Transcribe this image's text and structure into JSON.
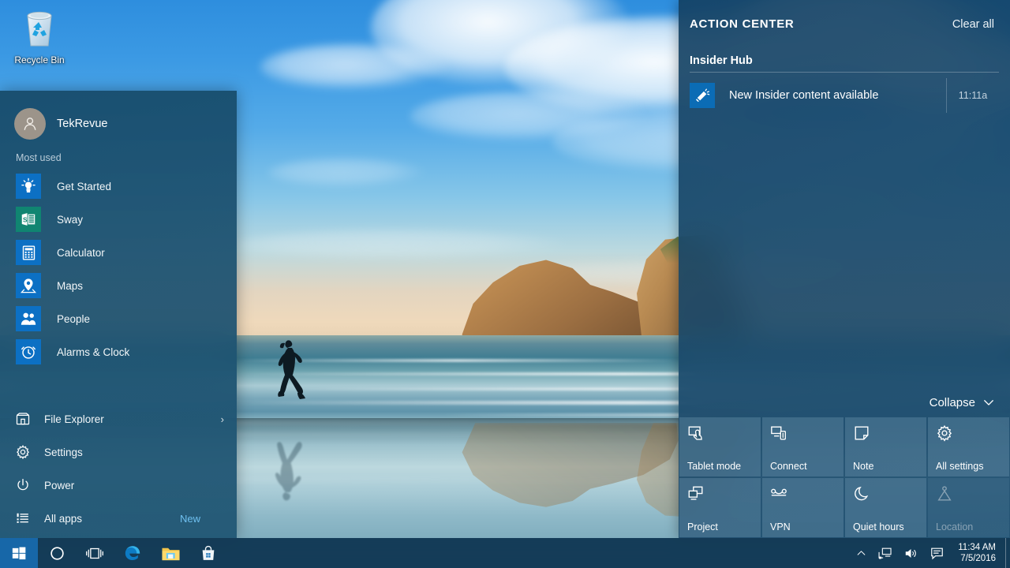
{
  "desktop": {
    "icons": [
      {
        "name": "recycle-bin",
        "label": "Recycle Bin",
        "icon": "recycle-bin-icon"
      }
    ],
    "wallpaper_description": "Wharariki Beach runner at sunrise"
  },
  "start_menu": {
    "user": {
      "name": "TekRevue",
      "avatar_icon": "user-avatar-icon",
      "avatar_color": "#9c948a"
    },
    "most_used_label": "Most used",
    "apps": [
      {
        "label": "Get Started",
        "icon": "lightbulb-icon",
        "tile_color": "#0c70c4"
      },
      {
        "label": "Sway",
        "icon": "sway-icon",
        "tile_color": "#108571"
      },
      {
        "label": "Calculator",
        "icon": "calculator-icon",
        "tile_color": "#0c70c4"
      },
      {
        "label": "Maps",
        "icon": "map-pin-icon",
        "tile_color": "#0c70c4"
      },
      {
        "label": "People",
        "icon": "people-icon",
        "tile_color": "#0c70c4"
      },
      {
        "label": "Alarms & Clock",
        "icon": "alarm-clock-icon",
        "tile_color": "#0c70c4"
      }
    ],
    "commands": [
      {
        "label": "File Explorer",
        "icon": "folder-explorer-icon",
        "aux": "›",
        "aux_type": "chevron"
      },
      {
        "label": "Settings",
        "icon": "gear-icon",
        "aux": "",
        "aux_type": "none"
      },
      {
        "label": "Power",
        "icon": "power-icon",
        "aux": "",
        "aux_type": "none"
      },
      {
        "label": "All apps",
        "icon": "list-icon",
        "aux": "New",
        "aux_type": "badge"
      }
    ],
    "new_badge_color": "#6fc0f0"
  },
  "action_center": {
    "title": "ACTION CENTER",
    "clear_all_label": "Clear all",
    "groups": [
      {
        "title": "Insider Hub",
        "notifications": [
          {
            "text": "New Insider content available",
            "time": "11:11a",
            "icon": "megaphone-icon",
            "icon_color": "#0b6cb5"
          }
        ]
      }
    ],
    "collapse_label": "Collapse",
    "collapse_icon": "chevron-down-icon",
    "quick_actions": [
      {
        "label": "Tablet mode",
        "icon": "tablet-mode-icon",
        "enabled": true
      },
      {
        "label": "Connect",
        "icon": "connect-icon",
        "enabled": true
      },
      {
        "label": "Note",
        "icon": "note-icon",
        "enabled": true
      },
      {
        "label": "All settings",
        "icon": "gear-icon",
        "enabled": true
      },
      {
        "label": "Project",
        "icon": "project-icon",
        "enabled": true
      },
      {
        "label": "VPN",
        "icon": "vpn-icon",
        "enabled": true
      },
      {
        "label": "Quiet hours",
        "icon": "moon-icon",
        "enabled": true
      },
      {
        "label": "Location",
        "icon": "location-icon",
        "enabled": false
      }
    ]
  },
  "taskbar": {
    "start_button": {
      "label": "Start",
      "icon": "windows-logo-icon",
      "active": true,
      "accent_color": "#1767a8"
    },
    "buttons": [
      {
        "label": "Cortana",
        "icon": "cortana-circle-icon"
      },
      {
        "label": "Task View",
        "icon": "task-view-icon"
      },
      {
        "label": "Microsoft Edge",
        "icon": "edge-icon"
      },
      {
        "label": "File Explorer",
        "icon": "file-explorer-icon"
      },
      {
        "label": "Store",
        "icon": "store-icon"
      }
    ],
    "tray": [
      {
        "label": "Show hidden icons",
        "icon": "chevron-up-icon"
      },
      {
        "label": "Network",
        "icon": "network-icon"
      },
      {
        "label": "Volume",
        "icon": "speaker-icon"
      },
      {
        "label": "Action Center",
        "icon": "action-center-icon"
      }
    ],
    "clock": {
      "time": "11:34 AM",
      "date": "7/5/2016"
    }
  }
}
